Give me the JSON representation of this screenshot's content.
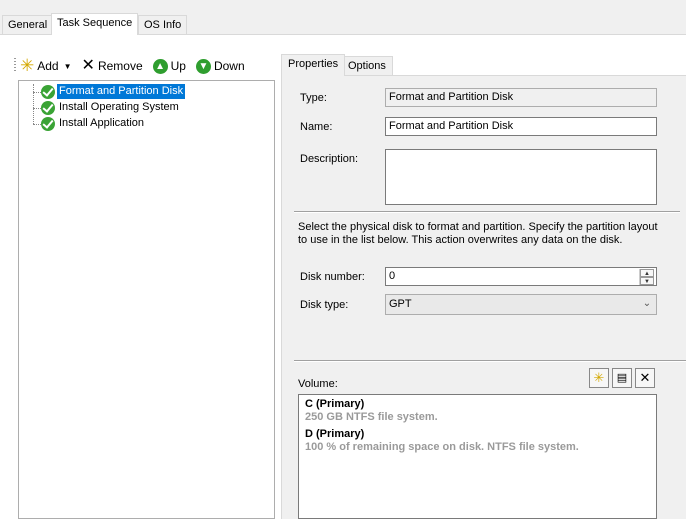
{
  "top_tabs": [
    {
      "label": "General",
      "active": false
    },
    {
      "label": "Task Sequence",
      "active": true
    },
    {
      "label": "OS Info",
      "active": false
    }
  ],
  "toolbar": {
    "add_label": "Add",
    "remove_label": "Remove",
    "up_label": "Up",
    "down_label": "Down"
  },
  "tree": {
    "items": [
      {
        "label": "Format and Partition Disk",
        "selected": true,
        "status": "success"
      },
      {
        "label": "Install Operating System",
        "selected": false,
        "status": "success"
      },
      {
        "label": "Install Application",
        "selected": false,
        "status": "success"
      }
    ]
  },
  "inner_tabs": [
    {
      "label": "Properties",
      "active": true
    },
    {
      "label": "Options",
      "active": false
    }
  ],
  "properties": {
    "type_label": "Type:",
    "type_value": "Format and Partition Disk",
    "name_label": "Name:",
    "name_value": "Format and Partition Disk",
    "description_label": "Description:",
    "description_value": "",
    "instructions": "Select the physical disk to format and partition.  Specify the partition layout to use in the list below. This action overwrites any data on the disk.",
    "disk_number_label": "Disk number:",
    "disk_number_value": "0",
    "disk_type_label": "Disk type:",
    "disk_type_value": "GPT",
    "volume_label": "Volume:",
    "volumes": [
      {
        "title": "C (Primary)",
        "description": "250 GB NTFS file system."
      },
      {
        "title": "D (Primary)",
        "description": "100 % of remaining space on disk. NTFS file system."
      }
    ]
  },
  "colors": {
    "selection": "#0078d7",
    "success_icon": "#3aa335"
  }
}
